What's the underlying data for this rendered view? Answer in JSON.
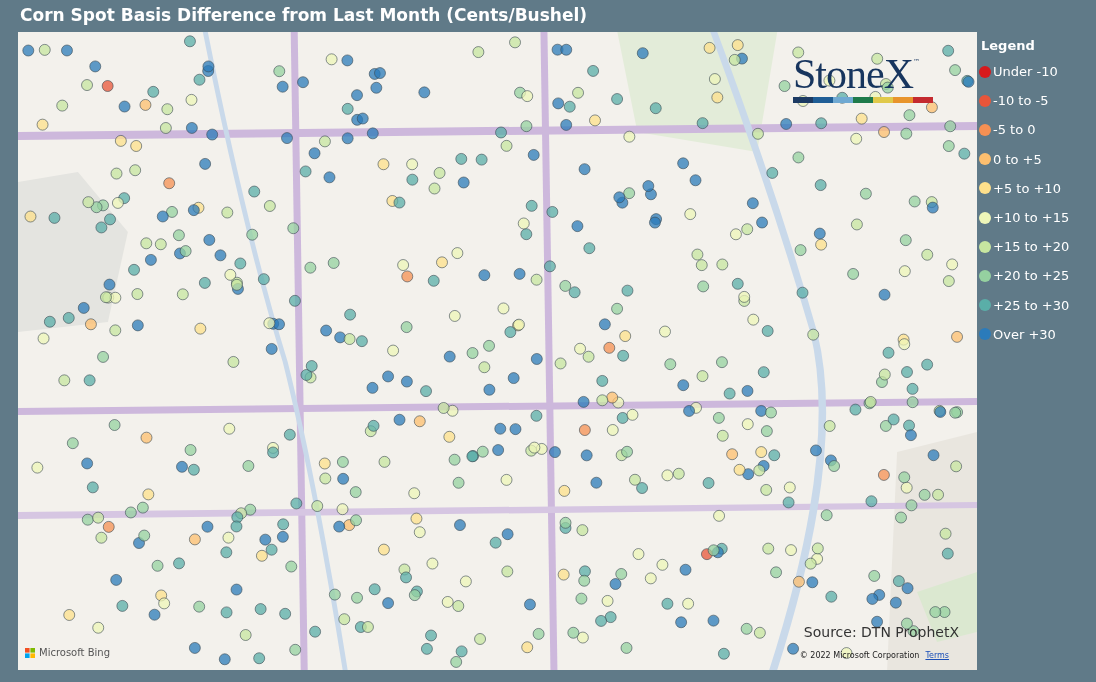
{
  "title": "Corn Spot Basis Difference from Last Month (Cents/Bushel)",
  "map": {
    "kind": "picture",
    "logo": {
      "text": "StoneX",
      "mark": "™"
    },
    "source": "Source: DTN ProphetX",
    "attribution": "Microsoft Bing",
    "copyright": "© 2022 Microsoft Corporation",
    "terms_link": "Terms"
  },
  "legend": {
    "title": "Legend",
    "items": [
      {
        "label": "Under -10",
        "color": "#d7191c"
      },
      {
        "label": "-10 to -5",
        "color": "#e8553a"
      },
      {
        "label": "-5 to 0",
        "color": "#f59053"
      },
      {
        "label": "0 to +5",
        "color": "#fdbf6f"
      },
      {
        "label": "+5 to +10",
        "color": "#fee08b"
      },
      {
        "label": "+10 to +15",
        "color": "#eef6b8"
      },
      {
        "label": "+15 to +20",
        "color": "#c7e6a0"
      },
      {
        "label": "+20 to +25",
        "color": "#95d1a0"
      },
      {
        "label": "+25 to +30",
        "color": "#5aaea8"
      },
      {
        "label": "Over +30",
        "color": "#2b7bba"
      }
    ]
  }
}
